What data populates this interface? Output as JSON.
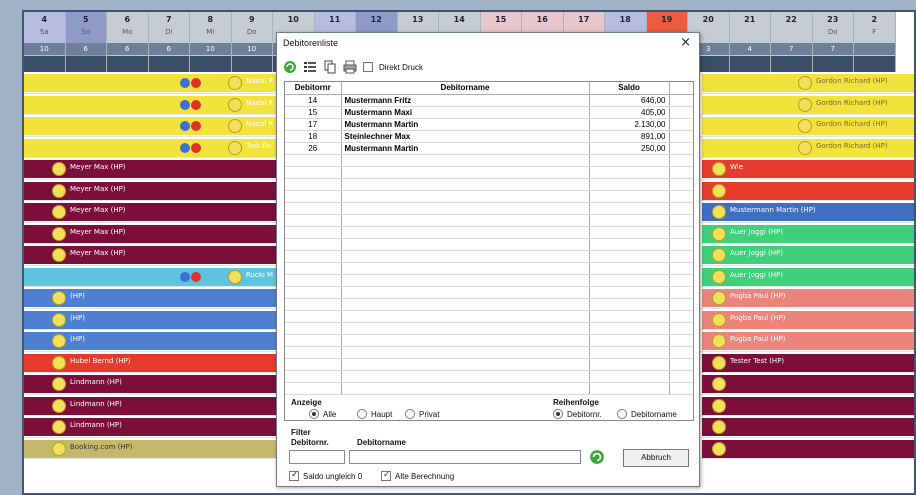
{
  "calendar": {
    "days": [
      {
        "num": "4",
        "wd": "Sa",
        "count": "10",
        "cls": "we2"
      },
      {
        "num": "5",
        "wd": "So",
        "count": "6",
        "cls": "we"
      },
      {
        "num": "6",
        "wd": "Mo",
        "count": "6",
        "cls": ""
      },
      {
        "num": "7",
        "wd": "Di",
        "count": "6",
        "cls": ""
      },
      {
        "num": "8",
        "wd": "Mi",
        "count": "10",
        "cls": ""
      },
      {
        "num": "9",
        "wd": "Do",
        "count": "10",
        "cls": ""
      },
      {
        "num": "10",
        "wd": "",
        "count": "",
        "cls": ""
      },
      {
        "num": "11",
        "wd": "",
        "count": "",
        "cls": "we2"
      },
      {
        "num": "12",
        "wd": "",
        "count": "",
        "cls": "we"
      },
      {
        "num": "13",
        "wd": "",
        "count": "",
        "cls": ""
      },
      {
        "num": "14",
        "wd": "",
        "count": "",
        "cls": ""
      },
      {
        "num": "15",
        "wd": "",
        "count": "",
        "cls": "pink"
      },
      {
        "num": "16",
        "wd": "",
        "count": "",
        "cls": "pink"
      },
      {
        "num": "17",
        "wd": "",
        "count": "",
        "cls": "pink"
      },
      {
        "num": "18",
        "wd": "",
        "count": "",
        "cls": "we2"
      },
      {
        "num": "19",
        "wd": "",
        "count": "",
        "cls": "red"
      },
      {
        "num": "20",
        "wd": "",
        "count": "3",
        "cls": ""
      },
      {
        "num": "21",
        "wd": "",
        "count": "4",
        "cls": ""
      },
      {
        "num": "22",
        "wd": "",
        "count": "7",
        "cls": ""
      },
      {
        "num": "23",
        "wd": "Do",
        "count": "7",
        "cls": ""
      },
      {
        "num": "2",
        "wd": "F",
        "count": "",
        "cls": ""
      }
    ],
    "left_rows": [
      {
        "color": "#f2e23c",
        "text": "Nadal R",
        "right": true
      },
      {
        "color": "#f2e23c",
        "text": "Nadal R",
        "right": true
      },
      {
        "color": "#f2e23c",
        "text": "Nadal R",
        "right": true
      },
      {
        "color": "#f2e23c",
        "text": "Test Ro",
        "right": true
      },
      {
        "color": "#7c0f3a",
        "text": "Meyer Max (HP)",
        "right": false
      },
      {
        "color": "#7c0f3a",
        "text": "Meyer Max (HP)",
        "right": false
      },
      {
        "color": "#7c0f3a",
        "text": "Meyer Max (HP)",
        "right": false
      },
      {
        "color": "#7c0f3a",
        "text": "Meyer Max (HP)",
        "right": false
      },
      {
        "color": "#7c0f3a",
        "text": "Meyer Max (HP)",
        "right": false
      },
      {
        "color": "#5dc4e0",
        "text": "Rucki M",
        "right": true
      },
      {
        "color": "#4f7fd0",
        "text": "(HP)",
        "right": false
      },
      {
        "color": "#4f7fd0",
        "text": "(HP)",
        "right": false
      },
      {
        "color": "#4f7fd0",
        "text": "(HP)",
        "right": false
      },
      {
        "color": "#e53b2c",
        "text": "Hubel Bernd (HP)",
        "right": false
      },
      {
        "color": "#7c0f3a",
        "text": "Lindmann (HP)",
        "right": false
      },
      {
        "color": "#7c0f3a",
        "text": "Lindmann (HP)",
        "right": false
      },
      {
        "color": "#7c0f3a",
        "text": "Lindmann (HP)",
        "right": false
      },
      {
        "color": "#c6b86a",
        "text": "Booking.com (HP)",
        "right": false
      }
    ],
    "right_rows": [
      {
        "color": "#f2e23c",
        "text": "Gordon Richard (HP)"
      },
      {
        "color": "#f2e23c",
        "text": "Gordon Richard (HP)"
      },
      {
        "color": "#f2e23c",
        "text": "Gordon Richard (HP)"
      },
      {
        "color": "#f2e23c",
        "text": "Gordon Richard (HP)"
      },
      {
        "color": "#e53b2c",
        "text": "Wie"
      },
      {
        "color": "#e53b2c",
        "text": ""
      },
      {
        "color": "#3f6fc0",
        "text": "Mustermann Martin (HP)"
      },
      {
        "color": "#3ed17a",
        "text": "Auer Joggi (HP)"
      },
      {
        "color": "#3ed17a",
        "text": "Auer Joggi (HP)"
      },
      {
        "color": "#3ed17a",
        "text": "Auer Joggi (HP)"
      },
      {
        "color": "#e9857d",
        "text": "Pogba Paul (HP)"
      },
      {
        "color": "#e9857d",
        "text": "Pogba Paul (HP)"
      },
      {
        "color": "#e9857d",
        "text": "Pogba Paul (HP)"
      },
      {
        "color": "#7c0f3a",
        "text": "Tester Test (HP)"
      },
      {
        "color": "#7c0f3a",
        "text": ""
      },
      {
        "color": "#7c0f3a",
        "text": ""
      },
      {
        "color": "#7c0f3a",
        "text": ""
      },
      {
        "color": "#7c0f3a",
        "text": ""
      }
    ]
  },
  "dialog": {
    "title": "Debitorenliste",
    "close": "×",
    "toolbar": {
      "icons": [
        "refresh-icon",
        "list-icon",
        "copy-icon",
        "print-icon"
      ],
      "direct_print_label": "Direkt Druck"
    },
    "table": {
      "headers": [
        "Debitornr",
        "Debitorname",
        "Saldo"
      ],
      "rows": [
        {
          "nr": "14",
          "name": "Mustermann Fritz",
          "saldo": "646,00"
        },
        {
          "nr": "15",
          "name": "Mustermann Maxi",
          "saldo": "405,00"
        },
        {
          "nr": "17",
          "name": "Mustermann Martin",
          "saldo": "2.130,00"
        },
        {
          "nr": "18",
          "name": "Steinlechner Max",
          "saldo": "891,00"
        },
        {
          "nr": "26",
          "name": "Mustermann Martin",
          "saldo": "250,00"
        }
      ]
    },
    "anzeige": {
      "label": "Anzeige",
      "options": [
        "Alle",
        "Haupt",
        "Privat"
      ],
      "selected": "Alle"
    },
    "reihenfolge": {
      "label": "Reihenfolge",
      "options": [
        "Debitornr.",
        "Debitorname"
      ],
      "selected": "Debitornr."
    },
    "filter": {
      "label": "Filter",
      "nr_label": "Debitornr.",
      "name_label": "Debitorname",
      "nr_value": "",
      "name_value": ""
    },
    "cancel_label": "Abbruch",
    "check_saldo": "Saldo ungleich 0",
    "check_alte": "Alte Berechnung"
  }
}
